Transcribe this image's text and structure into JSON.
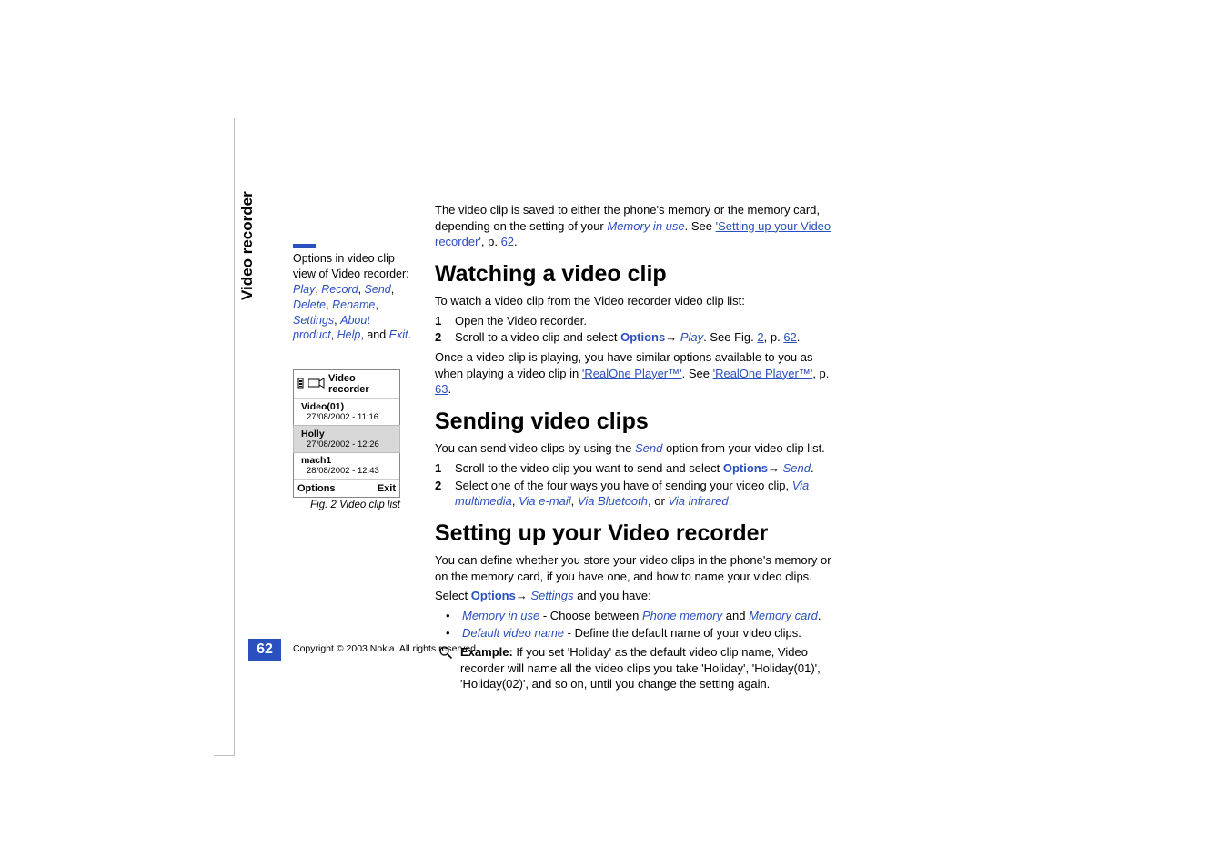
{
  "vertical_title": "Video recorder",
  "sidebar_note": {
    "prefix": "Options in video clip view of Video recorder: ",
    "items": [
      "Play",
      "Record",
      "Send",
      "Delete",
      "Rename",
      "Settings",
      "About product",
      "Help",
      "Exit"
    ],
    "and": ", and "
  },
  "intro": {
    "text_a": "The video clip is saved to either the phone's memory or the memory card, depending on the setting of your ",
    "mem_in_use": "Memory in use",
    "text_b": ". See ",
    "link": "'Setting up your Video recorder'",
    "text_c": ", p. ",
    "page": "62",
    "text_d": "."
  },
  "watch": {
    "heading": "Watching a video clip",
    "p1": "To watch a video clip from the Video recorder video clip list:",
    "step1": "Open the Video recorder.",
    "step2_a": "Scroll to a video clip and select ",
    "options": "Options",
    "arrow": "→ ",
    "play": "Play",
    "step2_b": ". See Fig. ",
    "fig_num": "2",
    "step2_c": ", p. ",
    "page": "62",
    "step2_d": ".",
    "p2_a": "Once a video clip is playing, you have similar options available to you as when playing a video clip in ",
    "realone1": "'RealOne Player™'",
    "p2_b": ". See ",
    "realone2": "'RealOne Player™'",
    "p2_c": ", p. ",
    "page2": "63",
    "p2_d": "."
  },
  "send": {
    "heading": "Sending video clips",
    "p1_a": "You can send video clips by using the ",
    "send_word": "Send",
    "p1_b": " option from your video clip list.",
    "step1_a": "Scroll to the video clip you want to send and select ",
    "options": "Options",
    "arrow": "→ ",
    "send_opt": "Send",
    "step1_b": ".",
    "step2_a": "Select one of the four ways you have of sending your video clip, ",
    "via_mm": "Via multimedia",
    "step2_b": ", ",
    "via_email": "Via e-mail",
    "step2_c": ", ",
    "via_bt": "Via Bluetooth",
    "step2_d": ", or ",
    "via_ir": "Via infrared",
    "step2_e": "."
  },
  "setup": {
    "heading": "Setting up your Video recorder",
    "p1": "You can define whether you store your video clips in the phone's memory or on the memory card, if you have one, and how to name your video clips.",
    "p2_a": "Select ",
    "options": "Options",
    "arrow": "→ ",
    "settings": "Settings",
    "p2_b": " and you have:",
    "b1_name": "Memory in use",
    "b1_a": " - Choose between ",
    "b1_pm": "Phone memory",
    "b1_b": " and ",
    "b1_mc": "Memory card",
    "b1_c": ".",
    "b2_name": "Default video name",
    "b2_a": " - Define the default name of your video clips.",
    "ex_label": "Example:",
    "ex_text": " If you set 'Holiday' as the default video clip name, Video recorder will name all the video clips you take 'Holiday', 'Holiday(01)', 'Holiday(02)', and so on, until you change the setting again."
  },
  "figure": {
    "title": "Video recorder",
    "items": [
      {
        "name": "Video(01)",
        "meta": "27/08/2002 - 11:16"
      },
      {
        "name": "Holly",
        "meta": "27/08/2002 - 12:26"
      },
      {
        "name": "mach1",
        "meta": "28/08/2002 - 12:43"
      }
    ],
    "left_softkey": "Options",
    "right_softkey": "Exit",
    "caption": "Fig. 2 Video clip list"
  },
  "page_number": "62",
  "copyright": "Copyright © 2003 Nokia. All rights reserved."
}
